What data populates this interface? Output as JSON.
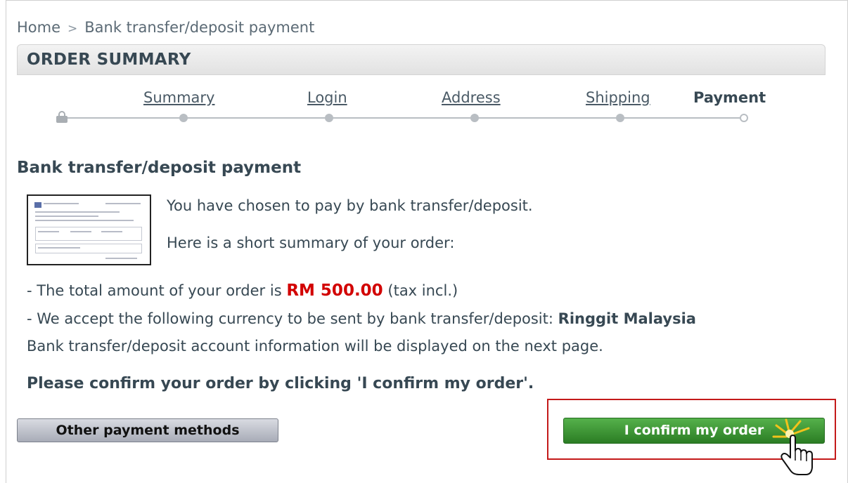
{
  "breadcrumb": {
    "home": "Home",
    "separator": ">",
    "current": "Bank transfer/deposit payment"
  },
  "header": {
    "title": "ORDER SUMMARY"
  },
  "steps": {
    "items": [
      {
        "label": "Summary",
        "state": "done"
      },
      {
        "label": "Login",
        "state": "done"
      },
      {
        "label": "Address",
        "state": "done"
      },
      {
        "label": "Shipping",
        "state": "done"
      },
      {
        "label": "Payment",
        "state": "current"
      }
    ]
  },
  "payment": {
    "title": "Bank transfer/deposit payment",
    "intro_chosen": "You have chosen to pay by bank transfer/deposit.",
    "intro_summary": "Here is a short summary of your order:",
    "total_prefix": "- The total amount of your order is",
    "total_amount": "RM 500.00",
    "total_suffix": "(tax incl.)",
    "currency_prefix": "- We accept the following currency to be sent by bank transfer/deposit:",
    "currency_name": "Ringgit Malaysia",
    "account_info": "Bank transfer/deposit account information will be displayed on the next page.",
    "confirm_note": "Please confirm your order by clicking 'I confirm my order'."
  },
  "buttons": {
    "other_methods": "Other payment methods",
    "confirm": "I confirm my order"
  },
  "colors": {
    "amount": "#d20000",
    "confirm_button": "#3a9231",
    "highlight_border": "#c41a1a"
  },
  "icons": {
    "lock": "lock-icon",
    "pointer": "hand-pointer-icon"
  }
}
